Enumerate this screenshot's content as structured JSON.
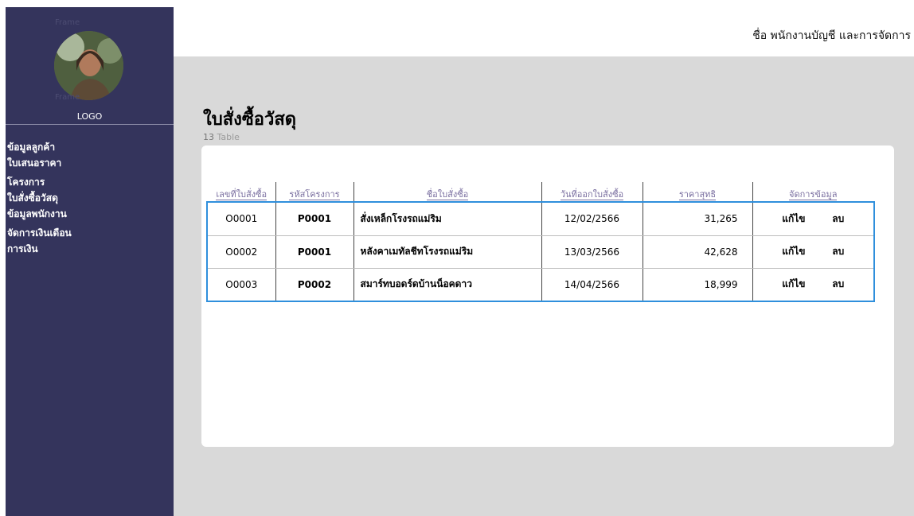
{
  "sidebar": {
    "frame_tag_1": "Frame",
    "frame_tag_2": "Frame",
    "logo_label": "LOGO",
    "items": [
      {
        "label": "ข้อมูลลูกค้า"
      },
      {
        "label": "ใบเสนอราคา"
      },
      {
        "label": "โครงการ"
      },
      {
        "label": "ใบสั่งซื้อวัสดุ"
      },
      {
        "label": "ข้อมูลพนักงาน"
      },
      {
        "label": "จัดการเงินเดือน"
      },
      {
        "label": "การเงิน"
      }
    ]
  },
  "header": {
    "user_name": "ชื่อ  พนักงานบัญชี  และการจัดการ"
  },
  "main": {
    "title": "ใบสั่งซื้อวัสดุ",
    "subtitle_prefix": "13",
    "subtitle_rest": " Table"
  },
  "table": {
    "columns": [
      "เลขที่ใบสั่งซื้อ",
      "รหัสโครงการ",
      "ชื่อใบสั่งซื้อ",
      "วันที่ออกใบสั่งซื้อ",
      "ราคาสุทธิ",
      "จัดการข้อมูล"
    ],
    "rows": [
      {
        "po_no": "O0001",
        "project_code": "P0001",
        "name": "สั่งเหล็กโรงรถแม่ริม",
        "date": "12/02/2566",
        "price": "31,265",
        "edit": "แก้ไข",
        "delete": "ลบ"
      },
      {
        "po_no": "O0002",
        "project_code": "P0001",
        "name": "หลังคาเมทัลชีทโรงรถแม่ริม",
        "date": "13/03/2566",
        "price": "42,628",
        "edit": "แก้ไข",
        "delete": "ลบ"
      },
      {
        "po_no": "O0003",
        "project_code": "P0002",
        "name": "สมาร์ทบอดร์ดบ้านน็อคดาว",
        "date": "14/04/2566",
        "price": "18,999",
        "edit": "แก้ไข",
        "delete": "ลบ"
      }
    ]
  },
  "colors": {
    "sidebar_bg": "#34345c",
    "content_bg": "#d9d9d9",
    "selection_outline": "#2f8fdc",
    "header_text": "#7a6fa0"
  }
}
